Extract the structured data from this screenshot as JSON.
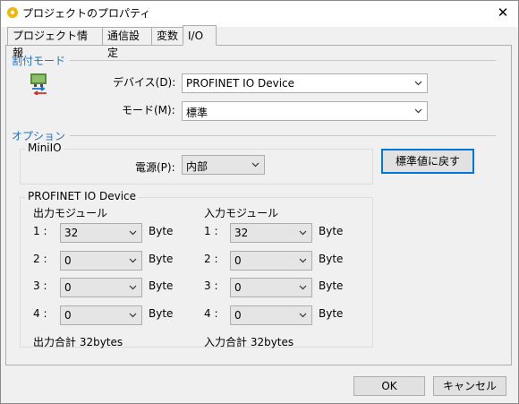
{
  "window": {
    "title": "プロジェクトのプロパティ",
    "close_symbol": "✕"
  },
  "tabs": [
    {
      "label": "プロジェクト情報",
      "active": false
    },
    {
      "label": "通信設定",
      "active": false
    },
    {
      "label": "変数",
      "active": false
    },
    {
      "label": "I/O",
      "active": true
    }
  ],
  "assign_mode": {
    "section_label": "割付モード",
    "device_label": "デバイス(D):",
    "device_value": "PROFINET IO Device",
    "mode_label": "モード(M):",
    "mode_value": "標準"
  },
  "options": {
    "section_label": "オプション",
    "miniio": {
      "group_title": "MiniIO",
      "power_label": "電源(P):",
      "power_value": "内部"
    },
    "reset_button_label": "標準値に戻す",
    "profinet": {
      "group_title": "PROFINET IO Device",
      "output": {
        "header": "出力モジュール",
        "rows": [
          {
            "index": "1 :",
            "value": "32",
            "unit": "Byte"
          },
          {
            "index": "2 :",
            "value": "0",
            "unit": "Byte"
          },
          {
            "index": "3 :",
            "value": "0",
            "unit": "Byte"
          },
          {
            "index": "4 :",
            "value": "0",
            "unit": "Byte"
          }
        ],
        "total": "出力合計 32bytes"
      },
      "input": {
        "header": "入力モジュール",
        "rows": [
          {
            "index": "1 :",
            "value": "32",
            "unit": "Byte"
          },
          {
            "index": "2 :",
            "value": "0",
            "unit": "Byte"
          },
          {
            "index": "3 :",
            "value": "0",
            "unit": "Byte"
          },
          {
            "index": "4 :",
            "value": "0",
            "unit": "Byte"
          }
        ],
        "total": "入力合計 32bytes"
      }
    }
  },
  "footer": {
    "ok_label": "OK",
    "cancel_label": "キャンセル"
  },
  "colors": {
    "section": "#1e73be",
    "default_button_border": "#0078d7"
  }
}
